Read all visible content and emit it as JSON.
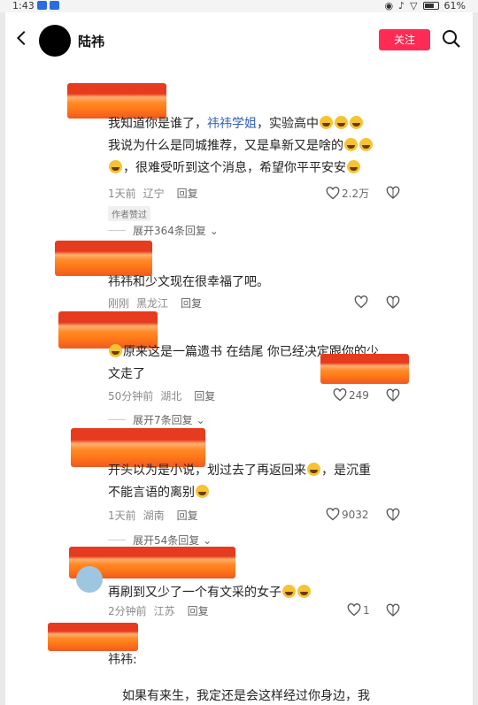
{
  "status": {
    "time": "1:43",
    "battery": "61%"
  },
  "header": {
    "name": "陆祎",
    "follow": "关注"
  },
  "comments": [
    {
      "text_a": "我知道你是谁了，",
      "mention": "祎祎学姐",
      "text_b": "，实验高中",
      "text_line2": "我说为什么是同城推荐，又是阜新又是啥的",
      "text_line3": "，很难受听到这个消息，希望你平平安安",
      "time": "1天前",
      "region": "辽宁",
      "reply": "回复",
      "likes": "2.2万",
      "tag": "作者赞过",
      "expand": "展开364条回复"
    },
    {
      "text": "祎祎和少文现在很幸福了吧。",
      "time": "刚刚",
      "region": "黑龙江",
      "reply": "回复"
    },
    {
      "text_line1": "原来这是一篇遗书 在结尾 你已经决定跟你的少",
      "text_line2": "文走了",
      "time": "50分钟前",
      "region": "湖北",
      "reply": "回复",
      "likes": "249",
      "expand": "展开7条回复"
    },
    {
      "text_line1": "开头以为是小说，划过去了再返回来",
      "text_line1b": "，是沉重",
      "text_line2": "不能言语的离别",
      "time": "1天前",
      "region": "湖南",
      "reply": "回复",
      "likes": "9032",
      "expand": "展开54条回复"
    },
    {
      "text": "再刷到又少了一个有文采的女子",
      "time": "2分钟前",
      "region": "江苏",
      "reply": "回复",
      "likes": "1"
    },
    {
      "text": "祎祎:",
      "bottom": "如果有来生，我定还是会这样经过你身边，我"
    }
  ]
}
